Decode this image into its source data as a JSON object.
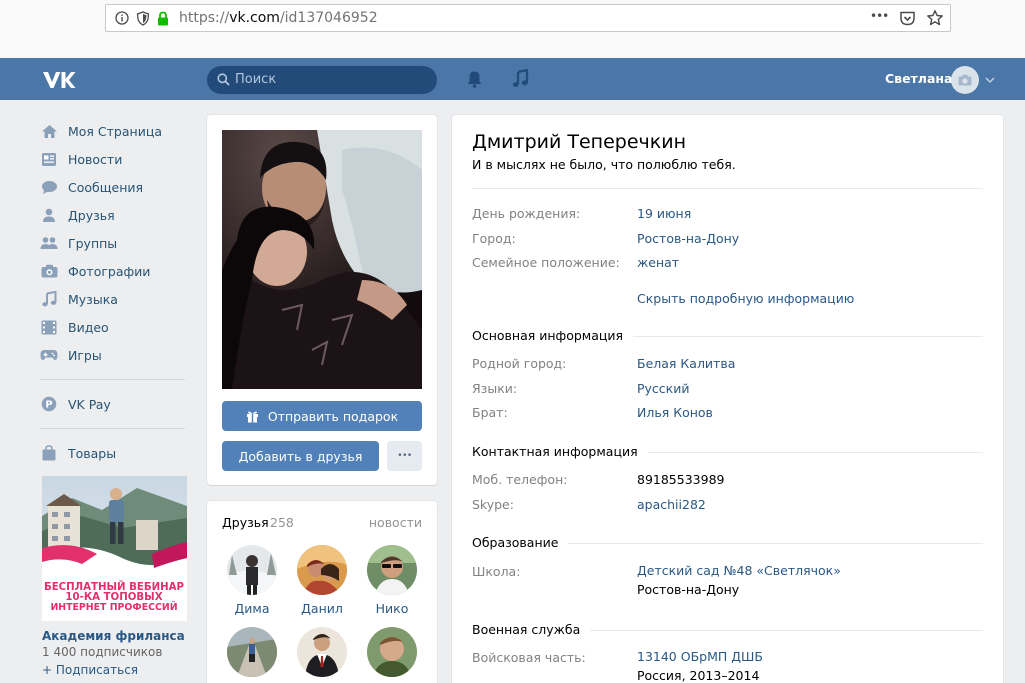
{
  "browser": {
    "url_prefix": "https://",
    "url_domain": "vk.com",
    "url_path": "/id137046952",
    "menu_glyph": "•••"
  },
  "header": {
    "search_placeholder": "Поиск",
    "user_name": "Светлана"
  },
  "sidebar": {
    "items": [
      {
        "label": "Моя Страница",
        "icon": "home-icon"
      },
      {
        "label": "Новости",
        "icon": "news-icon"
      },
      {
        "label": "Сообщения",
        "icon": "messages-icon"
      },
      {
        "label": "Друзья",
        "icon": "friends-icon"
      },
      {
        "label": "Группы",
        "icon": "groups-icon"
      },
      {
        "label": "Фотографии",
        "icon": "camera-icon"
      },
      {
        "label": "Музыка",
        "icon": "music-icon"
      },
      {
        "label": "Видео",
        "icon": "video-icon"
      },
      {
        "label": "Игры",
        "icon": "gamepad-icon"
      }
    ],
    "vkpay": "VK Pay",
    "goods": "Товары",
    "ad": {
      "line1": "БЕСПЛАТНЫЙ ВЕБИНАР",
      "line2": "10-КА ТОПОВЫХ",
      "line3": "ИНТЕРНЕТ ПРОФЕССИЙ",
      "org": "Академия фриланса",
      "subscribers": "1 400 подписчиков",
      "subscribe": "+ Подписаться"
    }
  },
  "profile_actions": {
    "gift": "Отправить подарок",
    "add_friend": "Добавить в друзья",
    "more": "•••"
  },
  "friends": {
    "title": "Друзья",
    "count": "258",
    "news": "новости",
    "list": [
      {
        "name": "Дима"
      },
      {
        "name": "Данил"
      },
      {
        "name": "Нико"
      },
      {
        "name": ""
      },
      {
        "name": ""
      },
      {
        "name": ""
      }
    ]
  },
  "profile": {
    "name": "Дмитрий Теперечкин",
    "status": "И в мыслях не было, что полюблю тебя.",
    "short": [
      {
        "label": "День рождения:",
        "value": "19 июня"
      },
      {
        "label": "Город:",
        "value": "Ростов-на-Дону"
      },
      {
        "label": "Семейное положение:",
        "value": "женат"
      }
    ],
    "toggle": "Скрыть подробную информацию",
    "main_title": "Основная информация",
    "main": [
      {
        "label": "Родной город:",
        "value": "Белая Калитва"
      },
      {
        "label": "Языки:",
        "value": "Русский"
      },
      {
        "label": "Брат:",
        "value": "Илья Конов"
      }
    ],
    "contact_title": "Контактная информация",
    "contact": [
      {
        "label": "Моб. телефон:",
        "value": "89185533989"
      },
      {
        "label": "Skype:",
        "value": "apachii282"
      }
    ],
    "edu_title": "Образование",
    "school_label": "Школа:",
    "school_value": "Детский сад №48 «Светлячок»",
    "school_city": "Ростов-на-Дону",
    "mil_title": "Военная служба",
    "mil_label": "Войсковая часть:",
    "mil_value": "13140 ОБрМП ДШБ",
    "mil_sub": "Россия, 2013–2014"
  },
  "colors": {
    "header": "#4a76a8",
    "link": "#2a5885",
    "button": "#5181b8",
    "background": "#edeef0"
  }
}
